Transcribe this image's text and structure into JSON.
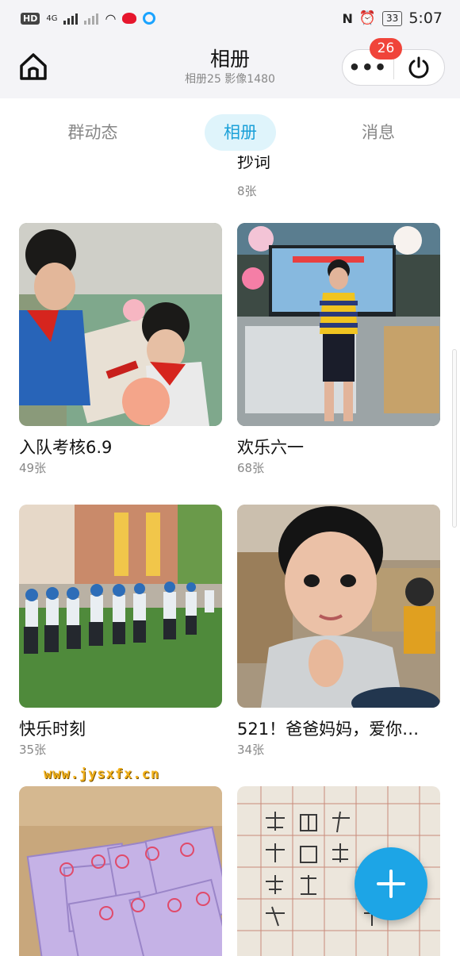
{
  "status_bar": {
    "hd": "HD",
    "network": "4G",
    "battery": "33",
    "time": "5:07"
  },
  "header": {
    "title": "相册",
    "subtitle": "相册25 影像1480",
    "notification_count": "26",
    "icons": {
      "home": "home-icon",
      "more": "more-icon",
      "power": "power-icon"
    }
  },
  "tabs": [
    {
      "label": "群动态",
      "active": false
    },
    {
      "label": "相册",
      "active": true
    },
    {
      "label": "消息",
      "active": false
    }
  ],
  "partial_album": {
    "title": "抄词",
    "count": "8张"
  },
  "albums": [
    {
      "title": "入队考核6.9",
      "count": "49张"
    },
    {
      "title": "欢乐六一",
      "count": "68张"
    },
    {
      "title": "快乐时刻",
      "count": "35张"
    },
    {
      "title": "521！爸爸妈妈，爱你…",
      "count": "34张"
    },
    {
      "title": "",
      "count": ""
    },
    {
      "title": "",
      "count": ""
    }
  ],
  "watermark": "www.jysxfx.cn",
  "fab": {
    "icon": "plus-icon"
  },
  "colors": {
    "accent": "#1da5e6",
    "badge": "#f0443a",
    "tab_active_bg": "#dff4fb"
  }
}
